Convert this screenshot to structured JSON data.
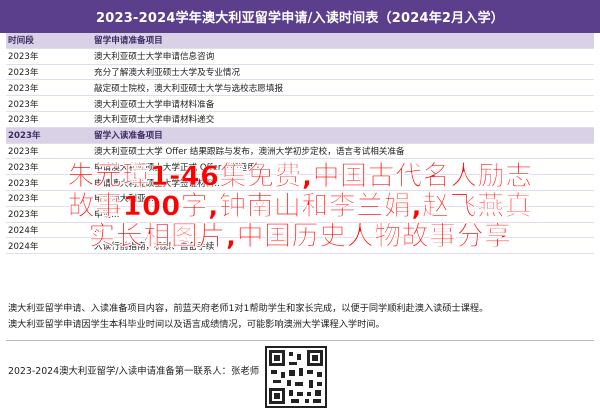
{
  "title": "2023-2024学年澳大利亚留学申请/入读时间表（2024年2月入学）",
  "header_row": {
    "col1": "时间段",
    "col2": "留学申请准备项目"
  },
  "rows": [
    {
      "time": "2023年",
      "item": "澳大利亚硕士大学申请信息咨询"
    },
    {
      "time": "2023年",
      "item": "充分了解澳大利亚硕士大学及专业情况"
    },
    {
      "time": "2023年",
      "item": "敲定硕士院校，澳大利亚硕士大学与选校志愿填报"
    },
    {
      "time": "2023年",
      "item": "澳大利亚硕士大学申请材料准备"
    },
    {
      "time": "2023年",
      "item": "澳大利亚硕士大学申请材料递交"
    }
  ],
  "section2": {
    "col1": "2023年",
    "col2": "留学入读准备项目"
  },
  "rows2": [
    {
      "time": "2023年",
      "item": "澳大利亚硕士大学 Offer 结果跟踪与发布，澳洲大学初步定校，语言考试相关准备"
    },
    {
      "time": "2023年",
      "item": "申请澳大利亚硕士大学正式 Offer（如适用）"
    },
    {
      "time": "2023年",
      "item": "申请澳大利亚硕士大学签证材料..."
    },
    {
      "time": "2023年",
      "item": "申请澳大利亚..."
    },
    {
      "time": "2023年",
      "item": "申请..."
    },
    {
      "time": "2024年",
      "item": "..."
    },
    {
      "time": "2024年",
      "item": "入读行前指南，机票、自备手续"
    }
  ],
  "footnotes": [
    "澳大利亚留学申请、入读准备项目内容，前蓝天府老师1对1帮助学生和家长完成，以便于同学顺利赴澳入读硕士课程。",
    "澳大利亚留学申请因学生本科毕业时间以及语言成绩情况，可能影响澳洲大学课程入学时间。"
  ],
  "contact": {
    "label": "2023-2024澳大利亚留学/入读申请准备第一联系人：",
    "name": "张老师"
  },
  "overlay": {
    "line1": "朱元璋1-46集免费,中国古代名人励志",
    "line2": "故事100字,钟南山和李兰娟,赵飞燕真",
    "line3": "实长相图片,中国历史人物故事分享"
  },
  "colors": {
    "header_bg": "#5c3f8c",
    "section_bg": "#d9d1e6",
    "overlay": "#ff0000"
  }
}
